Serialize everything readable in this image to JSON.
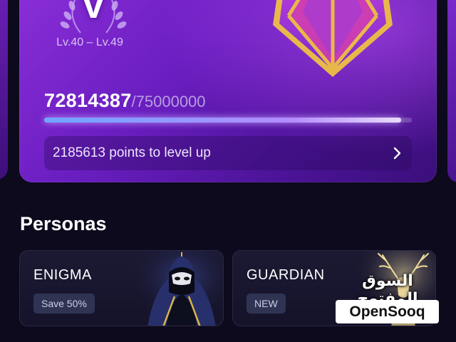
{
  "level_card": {
    "rank_letter": "V",
    "level_range": "Lv.40 – Lv.49",
    "points_current": "72814387",
    "points_total": "/75000000",
    "progress_fraction": 0.971,
    "levelup_text": "2185613 points to level up"
  },
  "personas": {
    "title": "Personas",
    "items": [
      {
        "name": "ENIGMA",
        "badge": "Save 50%"
      },
      {
        "name": "GUARDIAN",
        "badge": "NEW"
      }
    ]
  },
  "watermark": {
    "arabic": "السوق المفتوح",
    "logo": "OpenSooq"
  },
  "colors": {
    "background": "#0c0a1c",
    "card_purple": "#8a2ed8",
    "progress_accent": "#b58cff",
    "gem_gold": "#e8b84a",
    "gem_magenta": "#d43fae"
  }
}
